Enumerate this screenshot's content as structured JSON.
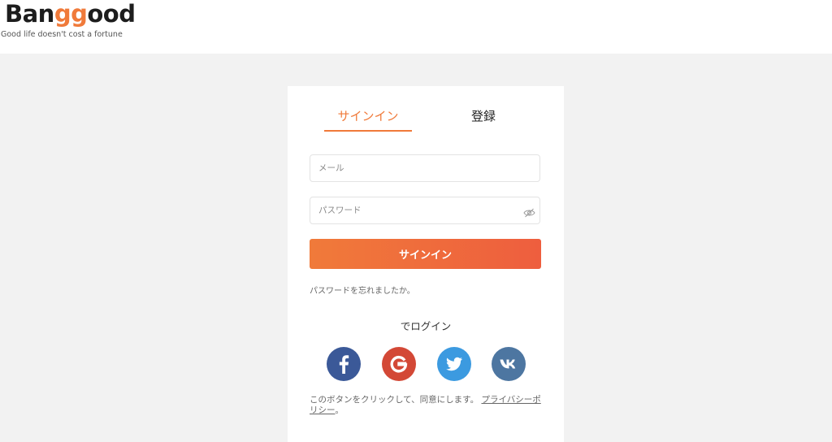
{
  "brand": {
    "logo_prefix": "Ban",
    "logo_accent": "gg",
    "logo_suffix": "ood",
    "tagline": "Good life doesn't cost a fortune",
    "accent_color": "#f07a3a"
  },
  "tabs": {
    "signin_label": "サインイン",
    "register_label": "登録",
    "active": "signin"
  },
  "form": {
    "email_placeholder": "メール",
    "email_value": "",
    "password_placeholder": "パスワード",
    "password_value": "",
    "password_toggle_icon": "eye-off-icon",
    "submit_label": "サインイン",
    "forgot_label": "パスワードを忘れましたか。"
  },
  "social": {
    "title": "でログイン",
    "providers": [
      {
        "name": "facebook",
        "icon": "facebook-icon",
        "color": "#3b5998"
      },
      {
        "name": "google",
        "icon": "google-icon",
        "color": "#d34836"
      },
      {
        "name": "twitter",
        "icon": "twitter-icon",
        "color": "#3c9ae0"
      },
      {
        "name": "vk",
        "icon": "vk-icon",
        "color": "#4d76a1"
      }
    ]
  },
  "consent": {
    "text": "このボタンをクリックして、同意にします。",
    "link_label": "プライバシーポリシー",
    "suffix": "。"
  }
}
